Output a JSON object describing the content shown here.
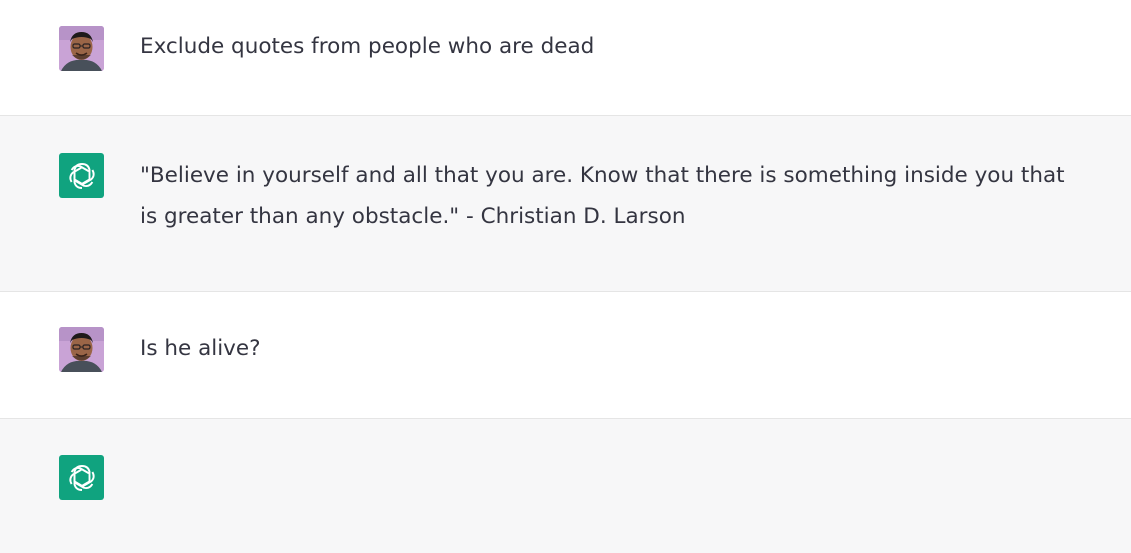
{
  "conversation": {
    "messages": [
      {
        "role": "user",
        "text": "Exclude quotes from people who are dead"
      },
      {
        "role": "assistant",
        "text": "\"Believe in yourself and all that you are. Know that there is something inside you that is greater than any obstacle.\" - Christian D. Larson"
      },
      {
        "role": "user",
        "text": "Is he alive?"
      },
      {
        "role": "assistant",
        "text": ""
      }
    ]
  },
  "icons": {
    "user_avatar": "user-avatar-photo",
    "assistant_avatar": "openai-logo-icon"
  },
  "colors": {
    "assistant_bg": "#f7f7f8",
    "user_bg": "#ffffff",
    "assistant_avatar_bg": "#10a37f",
    "text": "#343541",
    "divider": "#e5e5e5"
  }
}
